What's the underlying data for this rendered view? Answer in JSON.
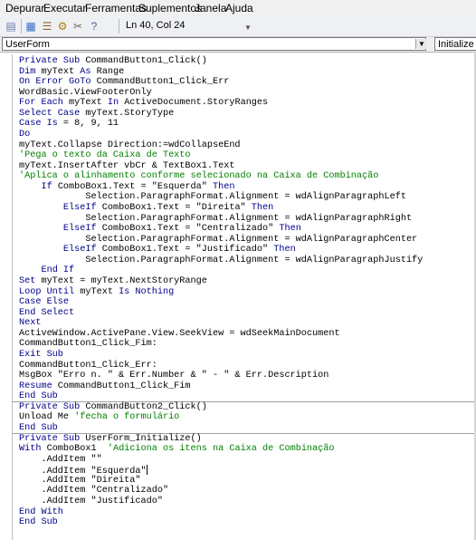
{
  "menubar": {
    "items": [
      "Depurar",
      "Executar",
      "Ferramentas",
      "Suplementos",
      "Janela",
      "Ajuda"
    ]
  },
  "toolbar": {
    "icons": [
      "design-mode-icon",
      "project-explorer-icon",
      "properties-icon",
      "object-browser-icon",
      "toolbox-icon",
      "help-icon"
    ],
    "position": "Ln 40, Col 24"
  },
  "selectors": {
    "object": "UserForm",
    "procedure": "Initialize"
  },
  "code": {
    "lines": [
      {
        "t": "Private Sub CommandButton1_Click()",
        "s": "kw"
      },
      {
        "t": "Dim myText As Range",
        "s": "kw"
      },
      {
        "t": "On Error GoTo CommandButton1_Click_Err",
        "s": "kw"
      },
      {
        "t": "WordBasic.ViewFooterOnly",
        "s": ""
      },
      {
        "t": "For Each myText In ActiveDocument.StoryRanges",
        "s": "kw"
      },
      {
        "t": "Select Case myText.StoryType",
        "s": "kw"
      },
      {
        "t": "Case Is = 8, 9, 11",
        "s": "kw"
      },
      {
        "t": "Do",
        "s": "kw"
      },
      {
        "t": "myText.Collapse Direction:=wdCollapseEnd",
        "s": ""
      },
      {
        "t": "'Pega o texto da Caixa de Texto",
        "s": "cm"
      },
      {
        "t": "myText.InsertAfter vbCr & TextBox1.Text",
        "s": ""
      },
      {
        "t": "'Aplica o alinhamento conforme selecionado na Caixa de Combinação",
        "s": "cm"
      },
      {
        "t": "    If ComboBox1.Text = \"Esquerda\" Then",
        "s": "kw"
      },
      {
        "t": "            Selection.ParagraphFormat.Alignment = wdAlignParagraphLeft",
        "s": ""
      },
      {
        "t": "        ElseIf ComboBox1.Text = \"Direita\" Then",
        "s": "kw"
      },
      {
        "t": "            Selection.ParagraphFormat.Alignment = wdAlignParagraphRight",
        "s": ""
      },
      {
        "t": "        ElseIf ComboBox1.Text = \"Centralizado\" Then",
        "s": "kw"
      },
      {
        "t": "            Selection.ParagraphFormat.Alignment = wdAlignParagraphCenter",
        "s": ""
      },
      {
        "t": "        ElseIf ComboBox1.Text = \"Justificado\" Then",
        "s": "kw"
      },
      {
        "t": "            Selection.ParagraphFormat.Alignment = wdAlignParagraphJustify",
        "s": ""
      },
      {
        "t": "    End If",
        "s": "kw"
      },
      {
        "t": "Set myText = myText.NextStoryRange",
        "s": "kw"
      },
      {
        "t": "Loop Until myText Is Nothing",
        "s": "kw"
      },
      {
        "t": "Case Else",
        "s": "kw"
      },
      {
        "t": "End Select",
        "s": "kw"
      },
      {
        "t": "Next",
        "s": "kw"
      },
      {
        "t": "ActiveWindow.ActivePane.View.SeekView = wdSeekMainDocument",
        "s": ""
      },
      {
        "t": "CommandButton1_Click_Fim:",
        "s": ""
      },
      {
        "t": "Exit Sub",
        "s": "kw"
      },
      {
        "t": "CommandButton1_Click_Err:",
        "s": ""
      },
      {
        "t": "MsgBox \"Erro n. \" & Err.Number & \" - \" & Err.Description",
        "s": ""
      },
      {
        "t": "Resume CommandButton1_Click_Fim",
        "s": "kw"
      },
      {
        "t": "End Sub",
        "s": "kw"
      },
      {
        "t": "Private Sub CommandButton2_Click()",
        "s": "kw"
      },
      {
        "t": "Unload Me 'fecha o formulário",
        "s": "mixed-unload"
      },
      {
        "t": "End Sub",
        "s": "kw"
      },
      {
        "t": "Private Sub UserForm_Initialize()",
        "s": "kw"
      },
      {
        "t": "With ComboBox1  'Adiciona os itens na Caixa de Combinação",
        "s": "mixed-with"
      },
      {
        "t": "    .AddItem \"\"",
        "s": ""
      },
      {
        "t": "    .AddItem \"Esquerda\"",
        "s": "caret"
      },
      {
        "t": "    .AddItem \"Direita\"",
        "s": ""
      },
      {
        "t": "    .AddItem \"Centralizado\"",
        "s": ""
      },
      {
        "t": "    .AddItem \"Justificado\"",
        "s": ""
      },
      {
        "t": "End With",
        "s": "kw"
      },
      {
        "t": "End Sub",
        "s": "kw"
      }
    ]
  }
}
